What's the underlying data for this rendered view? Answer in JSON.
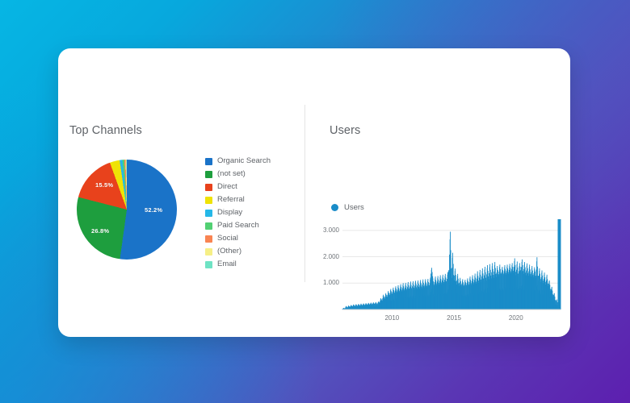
{
  "background": {
    "gradient_from": "#06b6e4",
    "gradient_mid": "#5253bd",
    "gradient_to": "#5d1faf"
  },
  "card": {
    "background_color": "#ffffff"
  },
  "panels": {
    "left": {
      "title": "Top Channels"
    },
    "right": {
      "title": "Users"
    }
  },
  "chart_data": [
    {
      "type": "pie",
      "title": "Top Channels",
      "categories": [
        "Organic Search",
        "(not set)",
        "Direct",
        "Referral",
        "Display",
        "Paid Search",
        "Social",
        "(Other)",
        "Email"
      ],
      "values": [
        52.2,
        26.8,
        15.5,
        3.2,
        0.9,
        0.6,
        0.4,
        0.3,
        0.1
      ],
      "value_unit": "%",
      "colors": [
        "#1a73c8",
        "#1e9e3e",
        "#e8421c",
        "#efe306",
        "#25b8e8",
        "#52d073",
        "#f98452",
        "#f6ef86",
        "#6fe3c4"
      ],
      "slice_labels": [
        {
          "category": "Organic Search",
          "text": "52.2%"
        },
        {
          "category": "(not set)",
          "text": "26.8%"
        },
        {
          "category": "Direct",
          "text": "15.5%"
        }
      ],
      "legend_position": "right",
      "legend_entries": [
        {
          "label": "Organic Search",
          "color": "#1a73c8"
        },
        {
          "label": "(not set)",
          "color": "#1e9e3e"
        },
        {
          "label": "Direct",
          "color": "#e8421c"
        },
        {
          "label": "Referral",
          "color": "#efe306"
        },
        {
          "label": "Display",
          "color": "#25b8e8"
        },
        {
          "label": "Paid Search",
          "color": "#52d073"
        },
        {
          "label": "Social",
          "color": "#f98452"
        },
        {
          "label": "(Other)",
          "color": "#f6ef86"
        },
        {
          "label": "Email",
          "color": "#6fe3c4"
        }
      ]
    },
    {
      "type": "area",
      "title": "Users",
      "xlabel": "",
      "ylabel": "",
      "grid": true,
      "legend_position": "top-left",
      "series": [
        {
          "name": "Users",
          "color": "#1a8cc8"
        }
      ],
      "yticks": [
        "1.000",
        "2.000",
        "3.000"
      ],
      "ytick_values": [
        1000,
        2000,
        3000
      ],
      "ylim": [
        0,
        3300
      ],
      "xticks": [
        "2010",
        "2015",
        "2020"
      ],
      "xtick_values": [
        2010,
        2015,
        2020
      ],
      "xlim": [
        2006.0,
        2023.6
      ],
      "x": [
        2006.0,
        2006.1,
        2006.2,
        2006.3,
        2006.4,
        2006.5,
        2006.6,
        2006.7,
        2006.8,
        2006.9,
        2007.0,
        2007.1,
        2007.2,
        2007.3,
        2007.4,
        2007.5,
        2007.6,
        2007.7,
        2007.8,
        2007.9,
        2008.0,
        2008.1,
        2008.2,
        2008.3,
        2008.4,
        2008.5,
        2008.6,
        2008.7,
        2008.8,
        2008.9,
        2009.0,
        2009.1,
        2009.2,
        2009.3,
        2009.4,
        2009.5,
        2009.6,
        2009.7,
        2009.8,
        2009.9,
        2010.0,
        2010.1,
        2010.2,
        2010.3,
        2010.4,
        2010.5,
        2010.6,
        2010.7,
        2010.8,
        2010.9,
        2011.0,
        2011.1,
        2011.2,
        2011.3,
        2011.4,
        2011.5,
        2011.6,
        2011.7,
        2011.8,
        2011.9,
        2012.0,
        2012.1,
        2012.2,
        2012.3,
        2012.4,
        2012.5,
        2012.6,
        2012.7,
        2012.8,
        2012.9,
        2013.0,
        2013.1,
        2013.2,
        2013.3,
        2013.4,
        2013.5,
        2013.6,
        2013.7,
        2013.8,
        2013.9,
        2014.0,
        2014.1,
        2014.2,
        2014.3,
        2014.4,
        2014.5,
        2014.6,
        2014.7,
        2014.8,
        2014.9,
        2015.0,
        2015.1,
        2015.2,
        2015.3,
        2015.4,
        2015.5,
        2015.6,
        2015.7,
        2015.8,
        2015.9,
        2016.0,
        2016.1,
        2016.2,
        2016.3,
        2016.4,
        2016.5,
        2016.6,
        2016.7,
        2016.8,
        2016.9,
        2017.0,
        2017.1,
        2017.2,
        2017.3,
        2017.4,
        2017.5,
        2017.6,
        2017.7,
        2017.8,
        2017.9,
        2018.0,
        2018.1,
        2018.2,
        2018.3,
        2018.4,
        2018.5,
        2018.6,
        2018.7,
        2018.8,
        2018.9,
        2019.0,
        2019.1,
        2019.2,
        2019.3,
        2019.4,
        2019.5,
        2019.6,
        2019.7,
        2019.8,
        2019.9,
        2020.0,
        2020.1,
        2020.2,
        2020.3,
        2020.4,
        2020.5,
        2020.6,
        2020.7,
        2020.8,
        2020.9,
        2021.0,
        2021.1,
        2021.2,
        2021.3,
        2021.4,
        2021.5,
        2021.6,
        2021.7,
        2021.8,
        2021.9,
        2022.0,
        2022.1,
        2022.2,
        2022.3,
        2022.4,
        2022.5,
        2022.6,
        2022.7,
        2022.8,
        2022.9,
        2023.0,
        2023.1,
        2023.2,
        2023.3,
        2023.4,
        2023.5,
        2023.6
      ],
      "values": [
        20,
        60,
        40,
        130,
        70,
        150,
        90,
        170,
        110,
        190,
        120,
        200,
        130,
        210,
        140,
        220,
        150,
        230,
        160,
        240,
        170,
        250,
        180,
        260,
        190,
        270,
        200,
        280,
        190,
        300,
        260,
        430,
        330,
        560,
        400,
        620,
        460,
        700,
        520,
        780,
        560,
        830,
        600,
        880,
        640,
        920,
        660,
        960,
        690,
        1000,
        700,
        1010,
        720,
        1040,
        740,
        1060,
        750,
        1070,
        770,
        1090,
        780,
        1100,
        800,
        1120,
        810,
        1140,
        820,
        1150,
        830,
        1160,
        860,
        1210,
        1580,
        1180,
        900,
        1250,
        920,
        1270,
        940,
        1300,
        960,
        1320,
        980,
        1350,
        1000,
        1400,
        1500,
        2950,
        1200,
        2150,
        1100,
        1550,
        950,
        1350,
        900,
        1200,
        870,
        1150,
        850,
        1130,
        880,
        1180,
        900,
        1250,
        930,
        1300,
        960,
        1360,
        980,
        1450,
        1010,
        1500,
        1050,
        1560,
        1080,
        1620,
        1100,
        1680,
        1150,
        1720,
        1180,
        1760,
        1200,
        1800,
        1230,
        1650,
        1260,
        1700,
        1280,
        1620,
        1300,
        1680,
        1320,
        1700,
        1350,
        1730,
        1380,
        1760,
        1400,
        1940,
        1300,
        1820,
        1250,
        1760,
        1420,
        1900,
        1350,
        1800,
        1300,
        1750,
        1280,
        1700,
        1250,
        1650,
        1220,
        1600,
        1200,
        1980,
        1100,
        1560,
        1050,
        1480,
        1000,
        1400,
        950,
        1320,
        900,
        1100,
        700,
        860,
        500,
        620,
        300,
        380,
        120
      ]
    }
  ]
}
